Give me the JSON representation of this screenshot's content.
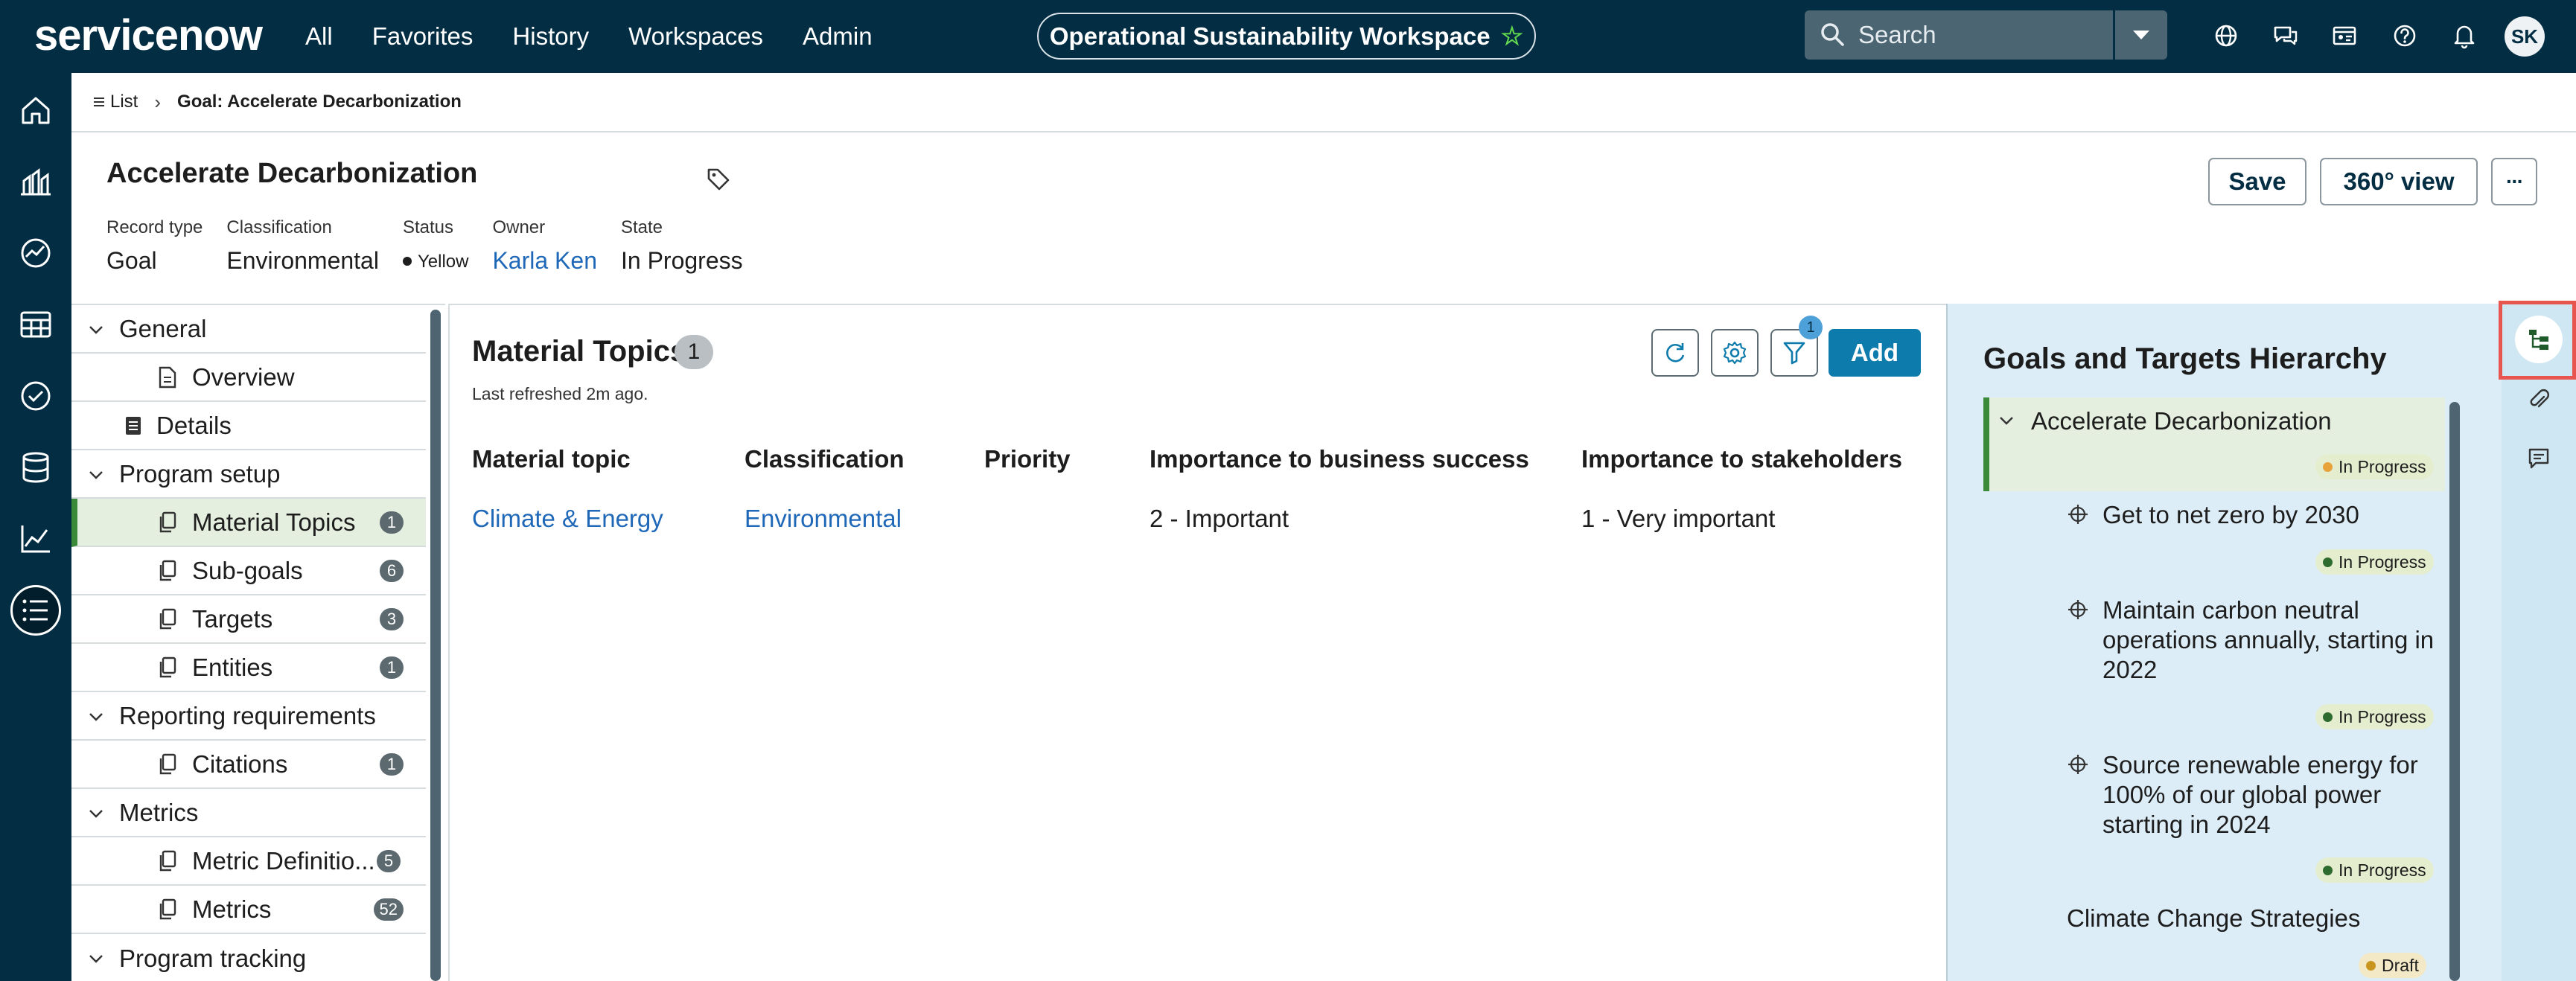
{
  "header": {
    "brand": "servicenow",
    "nav": [
      "All",
      "Favorites",
      "History",
      "Workspaces",
      "Admin"
    ],
    "workspace": "Operational Sustainability Workspace",
    "search_placeholder": "Search",
    "avatar_initials": "SK"
  },
  "breadcrumb": {
    "list_label": "List",
    "current": "Goal: Accelerate Decarbonization"
  },
  "record": {
    "title": "Accelerate Decarbonization",
    "fields": [
      {
        "label": "Record type",
        "value": "Goal"
      },
      {
        "label": "Classification",
        "value": "Environmental"
      },
      {
        "label": "Status",
        "value": "Yellow"
      },
      {
        "label": "Owner",
        "value": "Karla Ken"
      },
      {
        "label": "State",
        "value": "In Progress"
      }
    ],
    "buttons": {
      "save": "Save",
      "view360": "360° view",
      "more": "···"
    }
  },
  "tree": {
    "general": "General",
    "overview": "Overview",
    "details": "Details",
    "program_setup": "Program setup",
    "material_topics": {
      "label": "Material Topics",
      "count": "1"
    },
    "sub_goals": {
      "label": "Sub-goals",
      "count": "6"
    },
    "targets": {
      "label": "Targets",
      "count": "3"
    },
    "entities": {
      "label": "Entities",
      "count": "1"
    },
    "reporting": "Reporting requirements",
    "citations": {
      "label": "Citations",
      "count": "1"
    },
    "metrics_group": "Metrics",
    "metric_definitions": {
      "label": "Metric Definitio...",
      "count": "5"
    },
    "metrics": {
      "label": "Metrics",
      "count": "52"
    },
    "program_tracking": "Program tracking"
  },
  "main": {
    "title": "Material Topics",
    "count": "1",
    "refreshed": "Last refreshed 2m ago.",
    "filter_count": "1",
    "add_label": "Add",
    "columns": [
      "Material topic",
      "Classification",
      "Priority",
      "Importance to business success",
      "Importance to stakeholders"
    ],
    "rows": [
      {
        "topic": "Climate & Energy",
        "classification": "Environmental",
        "priority": "",
        "business": "2 - Important",
        "stakeholders": "1 - Very important"
      }
    ]
  },
  "hierarchy": {
    "title": "Goals and Targets Hierarchy",
    "root": {
      "label": "Accelerate Decarbonization",
      "state": "In Progress"
    },
    "children": [
      {
        "label": "Get to net zero by 2030",
        "state": "In Progress"
      },
      {
        "label_lines": [
          "Maintain carbon neutral",
          "operations annually, starting in",
          "2022"
        ],
        "state": "In Progress"
      },
      {
        "label_lines": [
          "Source renewable energy for",
          "100% of our global power",
          "starting in 2024"
        ],
        "state": "In Progress"
      },
      {
        "label": "Climate Change Strategies",
        "state": "Draft"
      }
    ]
  },
  "colors": {
    "header_bg": "#032d42",
    "brand_green": "#62d84e",
    "link_blue": "#1f68b8",
    "primary_button": "#0d7bac",
    "active_green": "#3b8a3a",
    "in_progress_dot": "#e8a23a",
    "draft_dot": "#c8961e",
    "highlight_red": "#e8554e"
  },
  "icons": [
    "home-icon",
    "dashboard-icon",
    "analytics-icon",
    "table-icon",
    "check-circle-icon",
    "database-icon",
    "chart-icon",
    "list-icon",
    "globe-icon",
    "chat-icon",
    "id-card-icon",
    "help-icon",
    "bell-icon",
    "tag-icon",
    "refresh-icon",
    "gear-icon",
    "filter-icon",
    "hierarchy-icon",
    "paperclip-icon",
    "comment-icon"
  ]
}
